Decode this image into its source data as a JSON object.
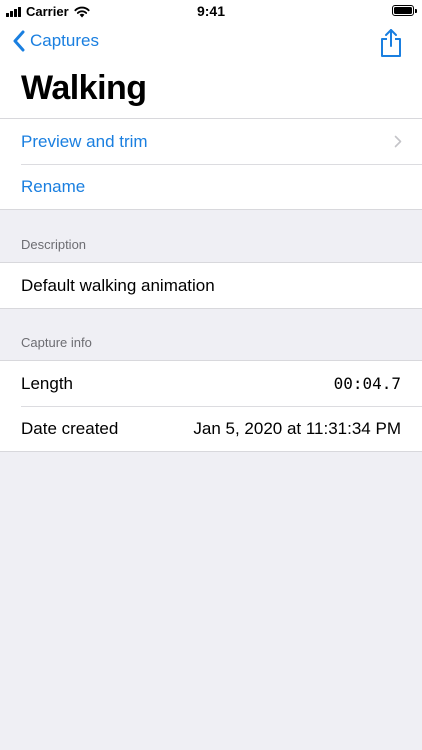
{
  "status_bar": {
    "carrier": "Carrier",
    "time": "9:41",
    "battery_level": 1.0
  },
  "nav": {
    "back_label": "Captures",
    "title": "Walking",
    "accent_color": "#1a7fe0"
  },
  "actions": {
    "preview_label": "Preview and trim",
    "rename_label": "Rename"
  },
  "description": {
    "header": "Description",
    "text": "Default walking animation"
  },
  "capture_info": {
    "header": "Capture info",
    "length_label": "Length",
    "length_value": "00:04.7",
    "date_label": "Date created",
    "date_value": "Jan 5, 2020 at 11:31:34 PM"
  }
}
